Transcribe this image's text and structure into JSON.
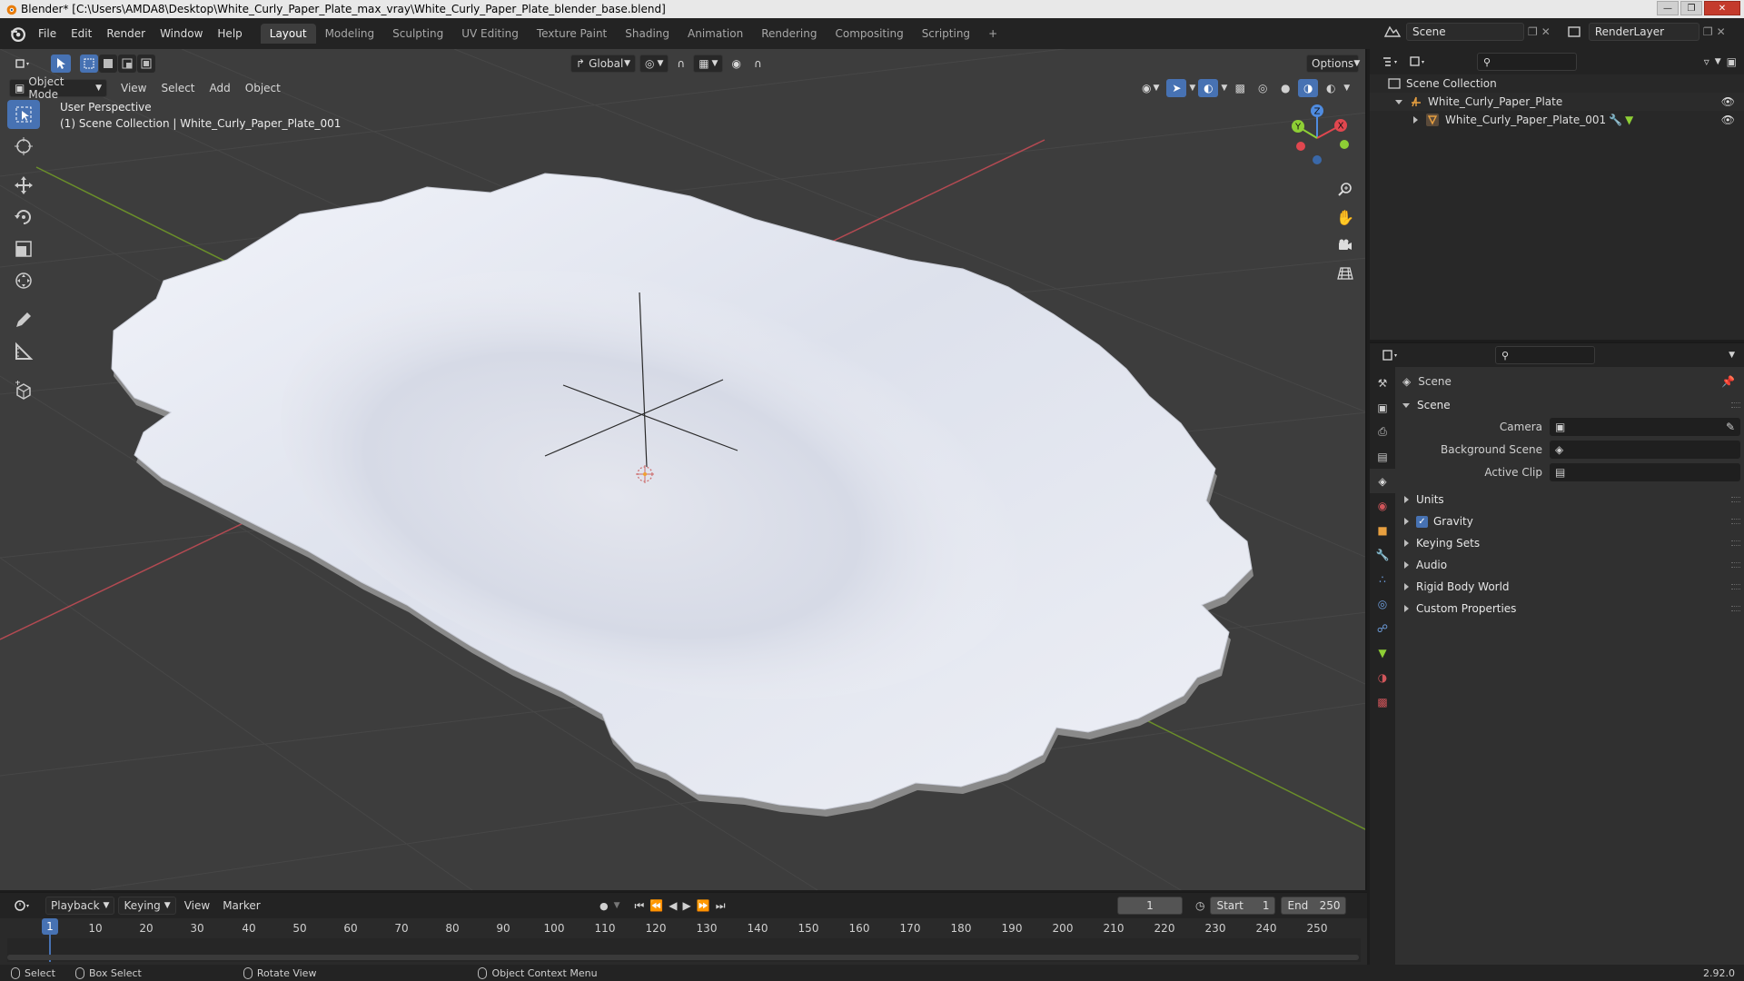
{
  "window": {
    "title": "Blender* [C:\\Users\\AMDA8\\Desktop\\White_Curly_Paper_Plate_max_vray\\White_Curly_Paper_Plate_blender_base.blend]"
  },
  "menu": [
    "File",
    "Edit",
    "Render",
    "Window",
    "Help"
  ],
  "workspaces": [
    "Layout",
    "Modeling",
    "Sculpting",
    "UV Editing",
    "Texture Paint",
    "Shading",
    "Animation",
    "Rendering",
    "Compositing",
    "Scripting",
    "+"
  ],
  "topright": {
    "scene": "Scene",
    "render_layer": "RenderLayer"
  },
  "viewport": {
    "transform_orientation": "Global",
    "options_label": "Options",
    "mode": "Object Mode",
    "header_menus": [
      "View",
      "Select",
      "Add",
      "Object"
    ],
    "info_line1": "User Perspective",
    "info_line2": "(1) Scene Collection | White_Curly_Paper_Plate_001",
    "gizmo_axes": {
      "x": "X",
      "y": "Y",
      "z": "Z"
    },
    "colors": {
      "background": "#3d3d3d",
      "x_axis": "#e0474f",
      "y_axis": "#8ecf35",
      "z_axis": "#4f8ce0",
      "select": "#4772b3"
    }
  },
  "tools": [
    "select-box-tool",
    "cursor-tool",
    "move-tool",
    "rotate-tool",
    "scale-tool",
    "transform-tool",
    "annotate-tool",
    "measure-tool",
    "add-cube-tool"
  ],
  "timeline": {
    "menus": [
      "Playback",
      "Keying",
      "View",
      "Marker"
    ],
    "current_frame": "1",
    "start_label": "Start",
    "start": "1",
    "end_label": "End",
    "end": "250",
    "ticks": [
      "10",
      "20",
      "30",
      "40",
      "50",
      "60",
      "70",
      "80",
      "90",
      "100",
      "110",
      "120",
      "130",
      "140",
      "150",
      "160",
      "170",
      "180",
      "190",
      "200",
      "210",
      "220",
      "230",
      "240",
      "250"
    ],
    "cursor_frame": "1"
  },
  "statusbar": {
    "select": "Select",
    "box_select": "Box Select",
    "rotate_view": "Rotate View",
    "context_menu": "Object Context Menu",
    "version": "2.92.0"
  },
  "outliner": {
    "root": "Scene Collection",
    "items": [
      {
        "label": "White_Curly_Paper_Plate"
      },
      {
        "label": "White_Curly_Paper_Plate_001"
      }
    ]
  },
  "properties": {
    "context": "Scene",
    "panel_title": "Scene",
    "fields": {
      "camera_label": "Camera",
      "background_scene_label": "Background Scene",
      "active_clip_label": "Active Clip"
    },
    "subpanels": [
      "Units",
      "Gravity",
      "Keying Sets",
      "Audio",
      "Rigid Body World",
      "Custom Properties"
    ],
    "gravity_checked": true
  }
}
